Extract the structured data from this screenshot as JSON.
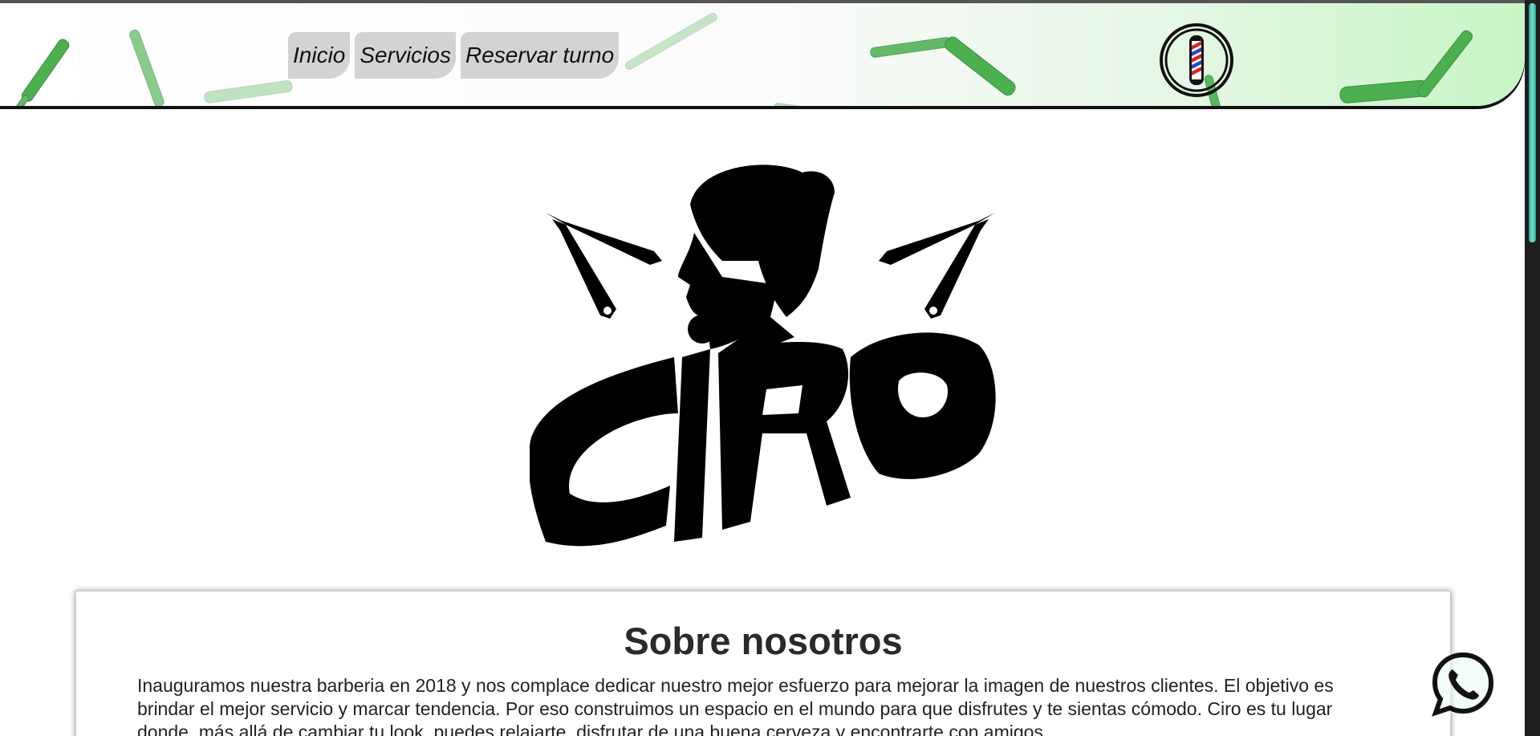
{
  "nav": {
    "items": [
      {
        "label": "Inicio"
      },
      {
        "label": "Servicios"
      },
      {
        "label": "Reservar turno"
      }
    ]
  },
  "logo": {
    "text": "CiRO"
  },
  "about": {
    "title": "Sobre nosotros",
    "text": "Inauguramos nuestra barberia en 2018 y nos complace dedicar nuestro mejor esfuerzo para mejorar la imagen de nuestros clientes. El objetivo es brindar el mejor servicio y marcar tendencia. Por eso construimos un espacio en el mundo para que disfrutes y te sientas cómodo. Ciro es tu lugar donde, más allá de cambiar tu look, puedes relajarte, disfrutar de una buena cerveza y encontrarte con amigos.."
  },
  "colors": {
    "header_accent": "#c8f5c6",
    "razor_green": "#4caf50",
    "nav_bg": "#d3d3d3",
    "scroll_thumb": "#2a9e8c"
  },
  "icons": {
    "header_decoration": "razor-icon",
    "barber_pole": "barber-pole-icon",
    "whatsapp": "whatsapp-icon"
  }
}
